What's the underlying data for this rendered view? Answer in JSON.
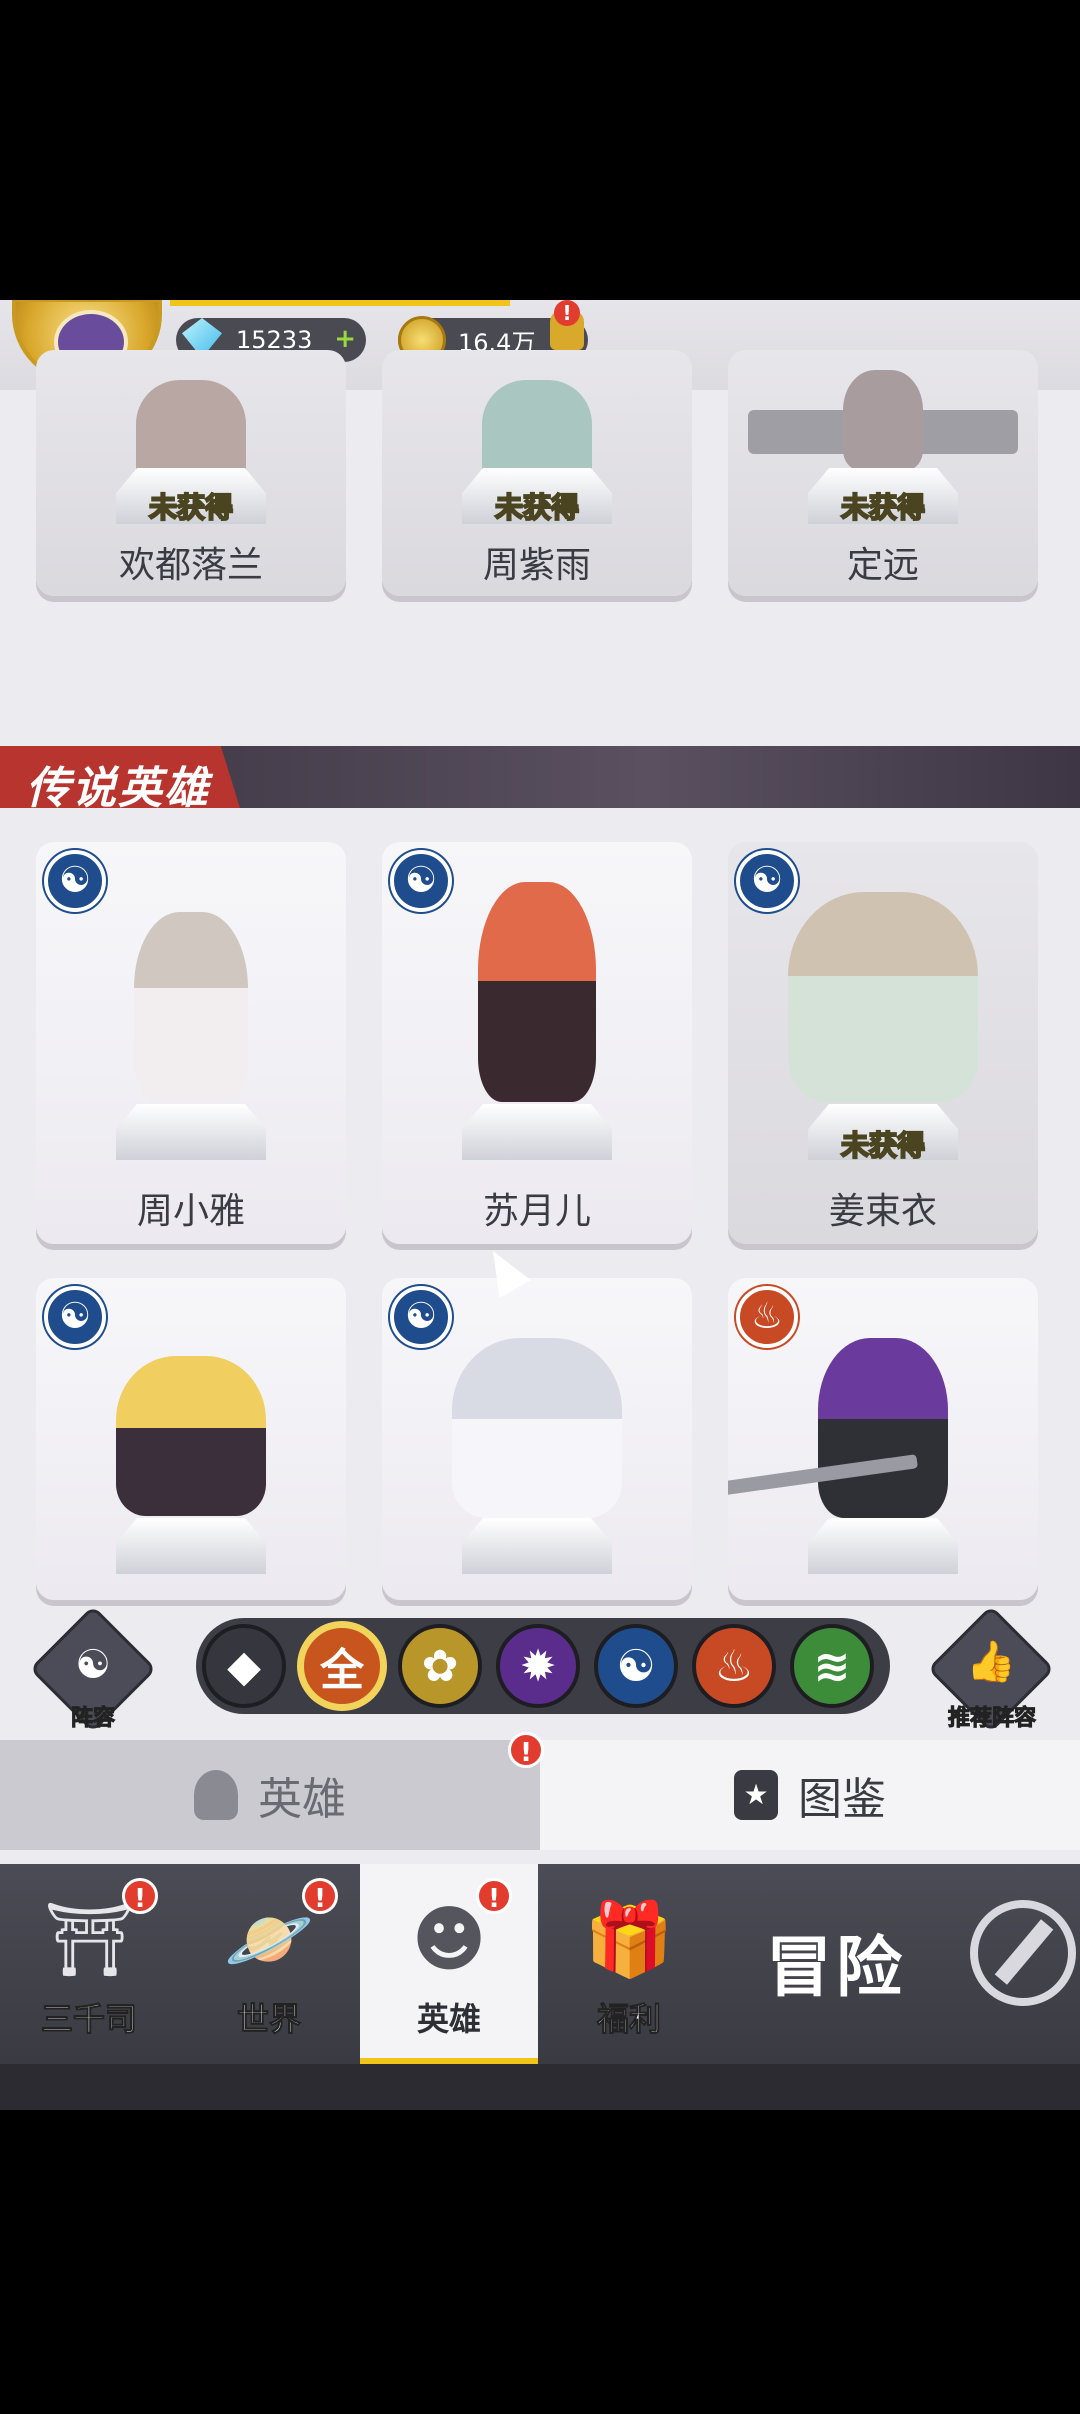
{
  "header": {
    "gems": "15233",
    "gold": "16.4万",
    "plus_symbol": "+"
  },
  "top_row": [
    {
      "name": "欢都落兰",
      "status": "未获得"
    },
    {
      "name": "周紫雨",
      "status": "未获得"
    },
    {
      "name": "定远",
      "status": "未获得"
    }
  ],
  "section_title": "传说英雄",
  "legend_row1": [
    {
      "name": "周小雅",
      "status": "",
      "faction_icon": "yin-yang-icon"
    },
    {
      "name": "苏月儿",
      "status": "",
      "faction_icon": "yin-yang-icon"
    },
    {
      "name": "姜束衣",
      "status": "未获得",
      "faction_icon": "yin-yang-icon"
    }
  ],
  "legend_row2": [
    {
      "faction_icon": "yin-yang-icon"
    },
    {
      "faction_icon": "yin-yang-icon"
    },
    {
      "faction_icon": "meditation-icon"
    }
  ],
  "filters": {
    "lineup_label": "阵容",
    "recommend_label": "推荐阵容",
    "all_label": "全",
    "buttons": [
      "diamond-icon",
      "all",
      "lotus-icon",
      "flame-icon",
      "yin-yang-icon",
      "meditation-icon",
      "dna-icon"
    ],
    "active": "all"
  },
  "subtabs": {
    "heroes": "英雄",
    "codex": "图鉴"
  },
  "nav": {
    "items": [
      "三千司",
      "世界",
      "英雄",
      "福利"
    ],
    "active": "英雄",
    "adventure": "冒险"
  },
  "colors": {
    "accent_gold": "#f0c419",
    "badge_red": "#e23c2e",
    "section_red": "#b8342e",
    "water_blue": "#1f4c8c",
    "fire_orange": "#c84a24"
  }
}
